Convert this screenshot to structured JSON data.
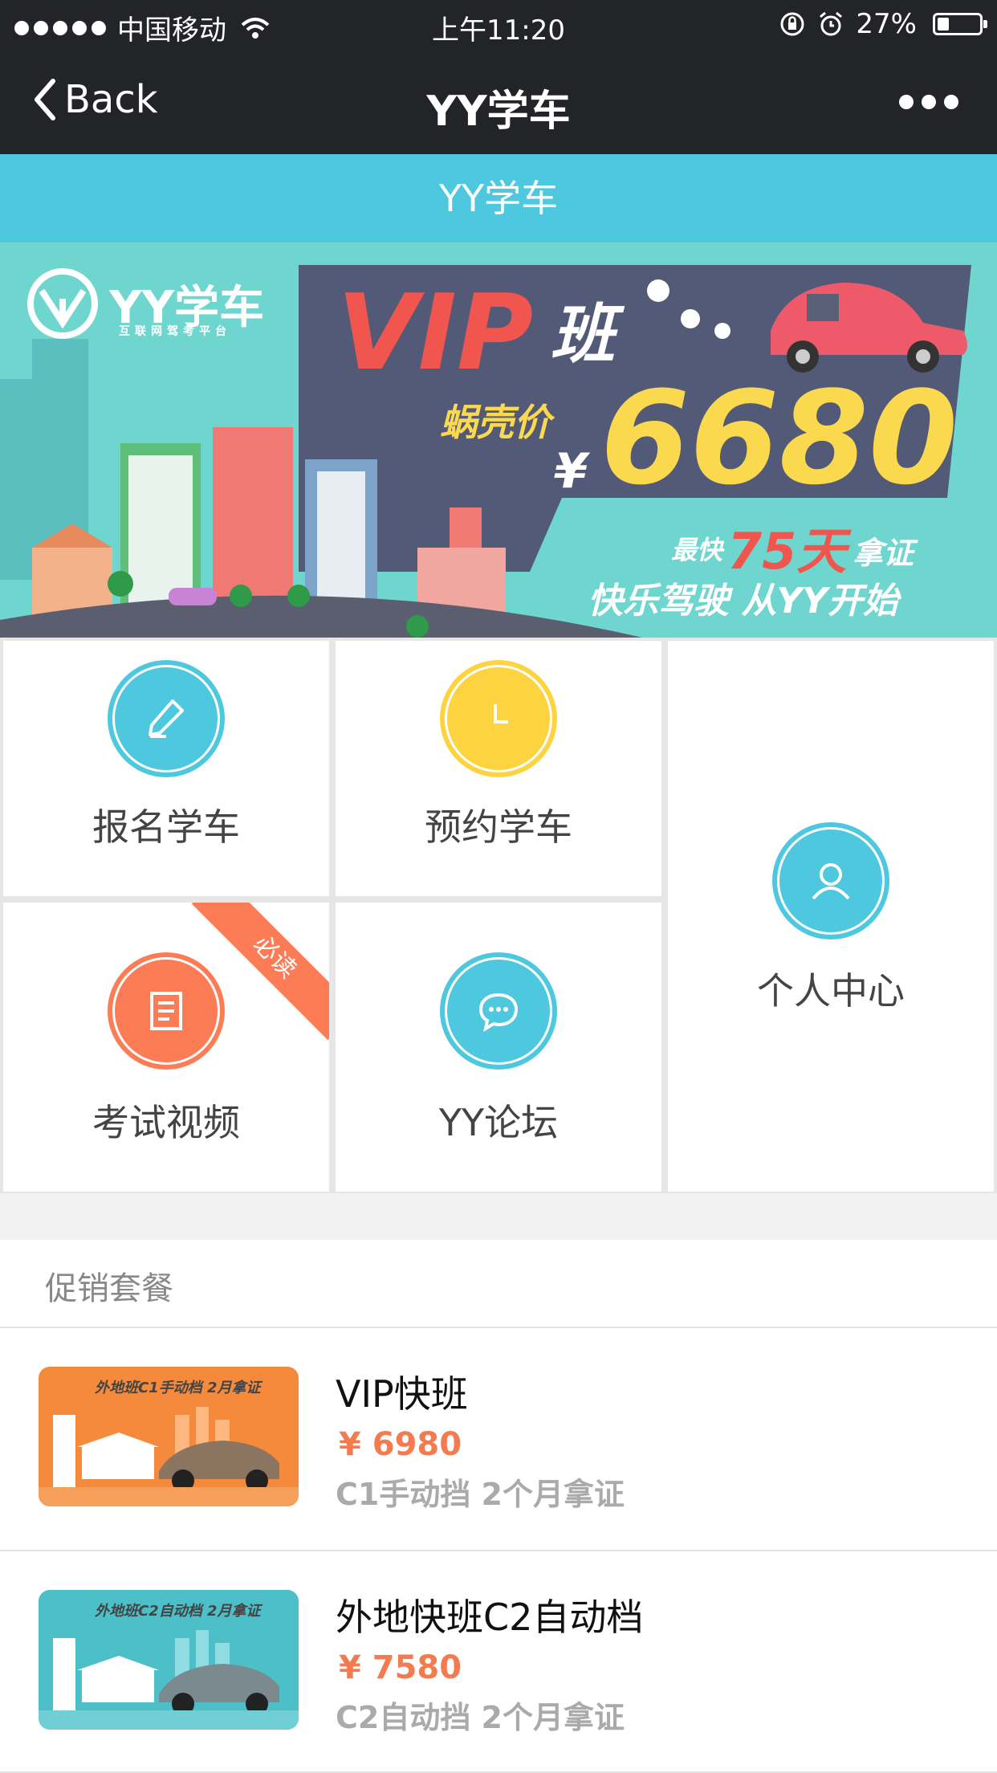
{
  "status_bar": {
    "carrier": "中国移动",
    "time": "上午11:20",
    "battery_percent": "27%",
    "battery_level": 0.27
  },
  "nav": {
    "back_label": "Back",
    "title": "YY学车"
  },
  "page_header": {
    "title": "YY学车"
  },
  "banner": {
    "brand_name": "YY学车",
    "brand_tagline": "互联网驾考平台",
    "vip_text": "VIP",
    "class_text": "班",
    "price_label": "蜗壳价",
    "currency": "¥",
    "price": "6680",
    "fastest_label": "最快",
    "days_text": "75天",
    "cert_label": "拿证",
    "slogan": "快乐驾驶 从YY开始"
  },
  "menu": {
    "signup": {
      "label": "报名学车",
      "color": "#4dc8df",
      "icon": "pencil-icon"
    },
    "booking": {
      "label": "预约学车",
      "color": "#fdd440",
      "icon": "clock-icon"
    },
    "profile": {
      "label": "个人中心",
      "color": "#4dc8df",
      "icon": "user-icon"
    },
    "exam_video": {
      "label": "考试视频",
      "color": "#fc7d55",
      "icon": "document-icon",
      "ribbon": "必读"
    },
    "forum": {
      "label": "YY论坛",
      "color": "#4dc8df",
      "icon": "chat-bubble-icon"
    }
  },
  "promotions": {
    "title": "促销套餐",
    "items": [
      {
        "name": "VIP快班",
        "price": "¥ 6980",
        "desc": "C1手动挡   2个月拿证",
        "thumb_caption": "外地班C1手动档 2月拿证",
        "thumb_color": "#f58a3c"
      },
      {
        "name": "外地快班C2自动档",
        "price": "¥ 7580",
        "desc": "C2自动挡  2个月拿证",
        "thumb_caption": "外地班C2自动档 2月拿证",
        "thumb_color": "#4cbfc8"
      }
    ]
  }
}
